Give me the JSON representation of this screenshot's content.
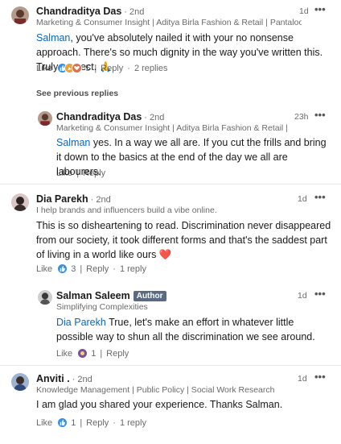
{
  "comments": [
    {
      "name": "Chandraditya Das",
      "degree": "· 2nd",
      "headline": "Marketing & Consumer Insight | Aditya Birla Fashion & Retail | Pantaloons",
      "time": "1d",
      "mention": "Salman",
      "text": ", you've absolutely nailed it with your no nonsense approach. There's so much dignity in the way you've written this. Truly respect. 🙏",
      "like_label": "Like",
      "reaction_count": "5",
      "reply_label": "Reply",
      "replies_label": "2 replies",
      "reactions": [
        "like-icon",
        "celebrate-icon",
        "love-icon"
      ]
    },
    {
      "name": "Chandraditya Das",
      "degree": "· 2nd",
      "headline": "Marketing & Consumer Insight | Aditya Birla Fashion & Retail | Pantal...",
      "time": "23h",
      "mention": "Salman",
      "text": " yes. In a way we all are. If you cut the frills and bring it down to the basics at the end of the day we all are labourers.",
      "like_label": "Like",
      "reply_label": "Reply"
    },
    {
      "name": "Dia Parekh",
      "degree": "· 2nd",
      "headline": "I help brands and influencers build a vibe online.",
      "time": "1d",
      "text": "This is so disheartening to read. Discrimination never disappeared from our society, it took different forms and that's the saddest part of living in a world like ours ❤️",
      "like_label": "Like",
      "reaction_count": "3",
      "reply_label": "Reply",
      "replies_label": "1 reply",
      "reactions": [
        "like-icon"
      ]
    },
    {
      "name": "Salman Saleem",
      "author_badge": "Author",
      "headline": "Simplifying Complexities",
      "time": "1d",
      "mention": "Dia Parekh",
      "text": " True, let's make an effort in whatever little possible way to shun all the discrimination we see around.",
      "like_label": "Like",
      "reaction_count": "1",
      "reply_label": "Reply",
      "reactions": [
        "insightful-icon"
      ]
    },
    {
      "name": "Anviti .",
      "degree": "· 2nd",
      "headline": "Knowledge Management | Public Policy | Social Work Research",
      "time": "1d",
      "text": "I am glad you shared your experience. Thanks Salman.",
      "like_label": "Like",
      "reaction_count": "1",
      "reply_label": "Reply",
      "replies_label": "1 reply",
      "reactions": [
        "like-icon"
      ]
    }
  ],
  "see_previous_label": "See previous replies",
  "more_label": "•••",
  "colors": {
    "link_blue": "#0a66c2",
    "muted": "#666666",
    "author_badge": "#5a6a80"
  }
}
